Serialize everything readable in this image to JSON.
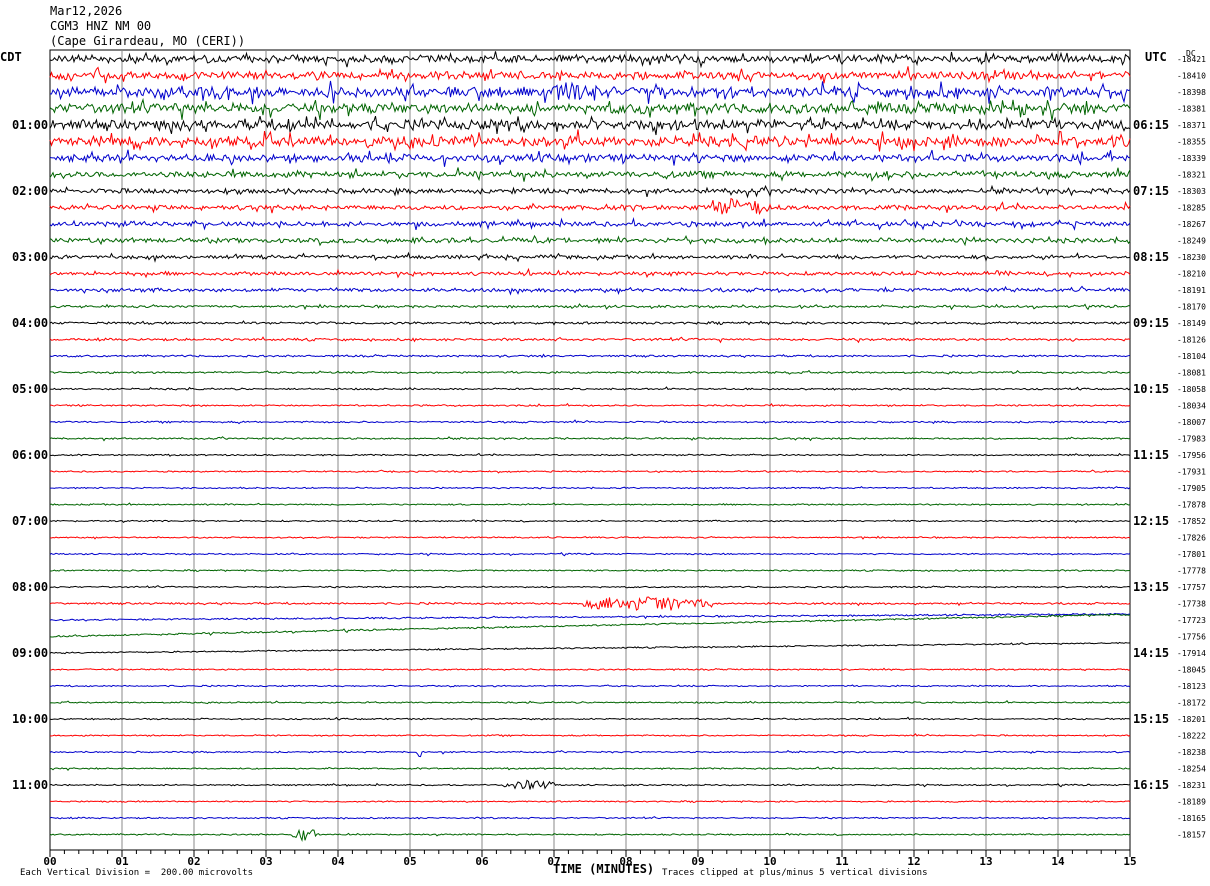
{
  "header": {
    "date": "Mar12,2026",
    "station": "CGM3 HNZ NM 00",
    "location": "(Cape Girardeau, MO (CERI))"
  },
  "left_timezone": "CDT",
  "right_timezone": "UTC",
  "dc_label": "DC",
  "chart_data": {
    "type": "line",
    "title": "",
    "xlabel": "TIME (MINUTES)",
    "xlim": [
      0,
      15
    ],
    "x_ticks": [
      "00",
      "01",
      "02",
      "03",
      "04",
      "05",
      "06",
      "07",
      "08",
      "09",
      "10",
      "11",
      "12",
      "13",
      "14",
      "15"
    ],
    "left_time_labels": [
      "01:00",
      "02:00",
      "03:00",
      "04:00",
      "05:00",
      "06:00",
      "07:00",
      "08:00",
      "09:00",
      "10:00",
      "11:00"
    ],
    "right_time_labels": [
      "06:15",
      "07:15",
      "08:15",
      "09:15",
      "10:15",
      "11:15",
      "12:15",
      "13:15",
      "14:15",
      "15:15",
      "16:15"
    ],
    "trace_colors": [
      "#000000",
      "#ff0000",
      "#0000cc",
      "#006400"
    ],
    "dc_offsets": [
      "-18421",
      "-18410",
      "-18398",
      "-18381",
      "-18371",
      "-18355",
      "-18339",
      "-18321",
      "-18303",
      "-18285",
      "-18267",
      "-18249",
      "-18230",
      "-18210",
      "-18191",
      "-18170",
      "-18149",
      "-18126",
      "-18104",
      "-18081",
      "-18058",
      "-18034",
      "-18007",
      "-17983",
      "-17956",
      "-17931",
      "-17905",
      "-17878",
      "-17852",
      "-17826",
      "-17801",
      "-17778",
      "-17757",
      "-17738",
      "-17723",
      "-17756",
      "-17914",
      "-18045",
      "-18123",
      "-18172",
      "-18201",
      "-18222",
      "-18238",
      "-18254",
      "-18231",
      "-18189",
      "-18165",
      "-18157"
    ],
    "activity_level": [
      3,
      3,
      4,
      4,
      4,
      4,
      3,
      2.5,
      2,
      2,
      2,
      2,
      1.5,
      1.5,
      1.5,
      1,
      1,
      1,
      0.8,
      0.8,
      0.7,
      0.7,
      0.7,
      0.7,
      0.6,
      0.6,
      0.6,
      0.6,
      0.6,
      0.6,
      0.6,
      0.6,
      0.6,
      0.8,
      0.7,
      0.7,
      0.6,
      0.6,
      0.6,
      0.6,
      0.6,
      0.6,
      0.6,
      0.6,
      0.6,
      0.6,
      0.6,
      0.6
    ],
    "events": [
      {
        "trace": 33,
        "start_min": 7.4,
        "end_min": 9.2,
        "amplitude": 7
      },
      {
        "trace": 42,
        "start_min": 5.1,
        "end_min": 5.15,
        "amplitude": 10
      },
      {
        "trace": 44,
        "start_min": 6.3,
        "end_min": 7.0,
        "amplitude": 4
      },
      {
        "trace": 47,
        "start_min": 3.35,
        "end_min": 3.7,
        "amplitude": 6
      },
      {
        "trace": 9,
        "start_min": 9.2,
        "end_min": 10.0,
        "amplitude": 6
      },
      {
        "trace": 2,
        "start_min": 7.0,
        "end_min": 7.5,
        "amplitude": 7
      }
    ],
    "drift_traces": [
      {
        "trace": 34,
        "from": 0,
        "to": -6
      },
      {
        "trace": 35,
        "from": 0,
        "to": -22
      },
      {
        "trace": 36,
        "from": 0,
        "to": -10
      }
    ]
  },
  "footer": {
    "scale": "Each Vertical Division =  200.00 microvolts",
    "clip": "Traces clipped at plus/minus 5 vertical divisions"
  }
}
